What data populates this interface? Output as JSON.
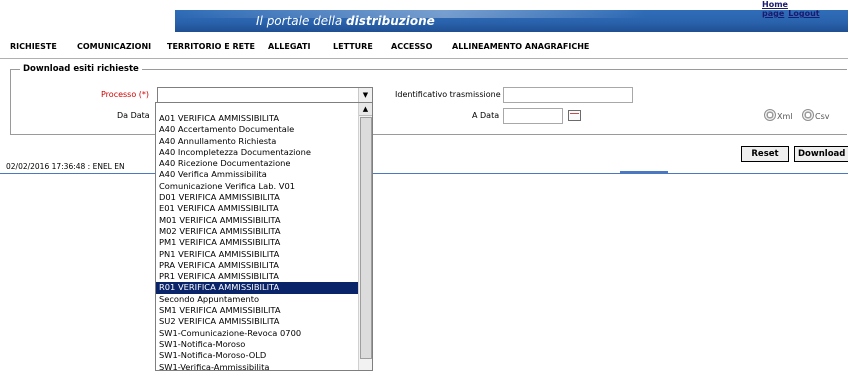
{
  "header": {
    "title_prefix": "Il portale della ",
    "title_bold": "distribuzione",
    "home_link": "Home page",
    "logout_link": "Logout"
  },
  "nav": {
    "items": [
      "RICHIESTE",
      "COMUNICAZIONI",
      "TERRITORIO E RETE",
      "ALLEGATI",
      "LETTURE",
      "ACCESSO",
      "ALLINEAMENTO ANAGRAFICHE"
    ]
  },
  "form": {
    "legend": "Download esiti richieste",
    "processo_label": "Processo (*)",
    "processo_value": "",
    "identificativo_label": "Identificativo trasmissione",
    "identificativo_value": "",
    "da_data_label": "Da Data",
    "da_data_value": "",
    "a_data_label": "A Data",
    "a_data_value": "",
    "format_xml_label": "Xml",
    "format_csv_label": "Csv"
  },
  "buttons": {
    "reset": "Reset",
    "download": "Download"
  },
  "status": {
    "text": "02/02/2016 17:36:48  :  ENEL EN"
  },
  "dropdown": {
    "options": [
      "A01 VERIFICA AMMISSIBILITA",
      "A40 Accertamento Documentale",
      "A40 Annullamento Richiesta",
      "A40 Incompletezza Documentazione",
      "A40 Ricezione Documentazione",
      "A40 Verifica Ammissibilita",
      "Comunicazione Verifica Lab. V01",
      "D01 VERIFICA AMMISSIBILITA",
      "E01 VERIFICA AMMISSIBILITA",
      "M01 VERIFICA AMMISSIBILITA",
      "M02 VERIFICA AMMISSIBILITA",
      "PM1 VERIFICA AMMISSIBILITA",
      "PN1 VERIFICA AMMISSIBILITA",
      "PRA VERIFICA AMMISSIBILITA",
      "PR1 VERIFICA AMMISSIBILITA",
      "R01 VERIFICA AMMISSIBILITA",
      "Secondo Appuntamento",
      "SM1 VERIFICA AMMISSIBILITA",
      "SU2 VERIFICA AMMISSIBILITA",
      "SW1-Comunicazione-Revoca 0700",
      "SW1-Notifica-Moroso",
      "SW1-Notifica-Moroso-OLD",
      "SW1-Verifica-Ammissibilita"
    ],
    "highlighted": "R01 VERIFICA AMMISSIBILITA"
  },
  "colors": {
    "header_blue": "#2a63ad",
    "highlight": "#0a246a",
    "required_red": "#d00000"
  }
}
